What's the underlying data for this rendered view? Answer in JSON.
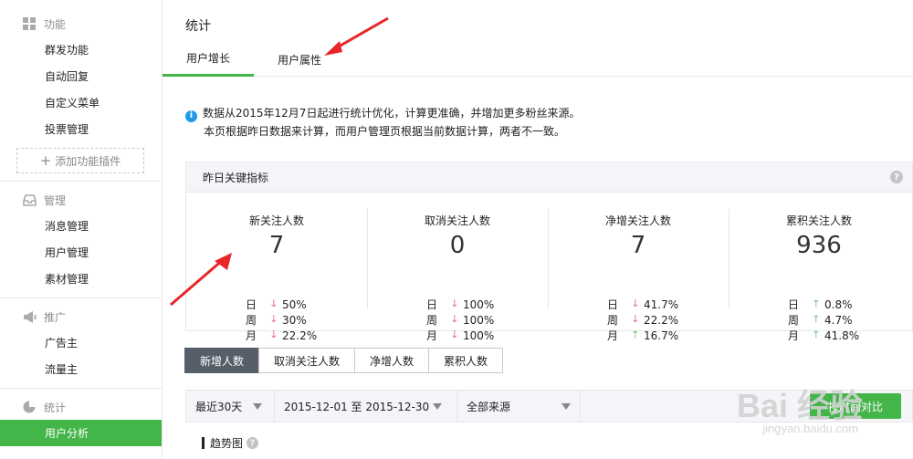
{
  "sidebar": {
    "sections": [
      {
        "title": "功能",
        "icon": "grid-icon",
        "items": [
          "群发功能",
          "自动回复",
          "自定义菜单",
          "投票管理"
        ]
      },
      {
        "title": "管理",
        "icon": "inbox-icon",
        "items": [
          "消息管理",
          "用户管理",
          "素材管理"
        ]
      },
      {
        "title": "推广",
        "icon": "megaphone-icon",
        "items": [
          "广告主",
          "流量主"
        ]
      },
      {
        "title": "统计",
        "icon": "pie-chart-icon",
        "items": [
          "用户分析"
        ]
      }
    ],
    "add_plugin": "添加功能插件",
    "active_item": "用户分析"
  },
  "page": {
    "title": "统计"
  },
  "tabs": [
    {
      "label": "用户增长",
      "active": true
    },
    {
      "label": "用户属性",
      "active": false
    }
  ],
  "notice": {
    "line1": "数据从2015年12月7日起进行统计优化，计算更准确，并增加更多粉丝来源。",
    "line2": "本页根据昨日数据来计算，而用户管理页根据当前数据计算，两者不一致。"
  },
  "kpi": {
    "header": "昨日关键指标",
    "cards": [
      {
        "label": "新关注人数",
        "value": "7",
        "rows": [
          {
            "period": "日",
            "dir": "down",
            "pct": "50%"
          },
          {
            "period": "周",
            "dir": "down",
            "pct": "30%"
          },
          {
            "period": "月",
            "dir": "down",
            "pct": "22.2%"
          }
        ]
      },
      {
        "label": "取消关注人数",
        "value": "0",
        "rows": [
          {
            "period": "日",
            "dir": "down",
            "pct": "100%"
          },
          {
            "period": "周",
            "dir": "down",
            "pct": "100%"
          },
          {
            "period": "月",
            "dir": "down",
            "pct": "100%"
          }
        ]
      },
      {
        "label": "净增关注人数",
        "value": "7",
        "rows": [
          {
            "period": "日",
            "dir": "down",
            "pct": "41.7%"
          },
          {
            "period": "周",
            "dir": "down",
            "pct": "22.2%"
          },
          {
            "period": "月",
            "dir": "up",
            "pct": "16.7%"
          }
        ]
      },
      {
        "label": "累积关注人数",
        "value": "936",
        "rows": [
          {
            "period": "日",
            "dir": "up",
            "pct": "0.8%"
          },
          {
            "period": "周",
            "dir": "up",
            "pct": "4.7%"
          },
          {
            "period": "月",
            "dir": "up",
            "pct": "41.8%"
          }
        ]
      }
    ]
  },
  "metric_tabs": [
    "新增人数",
    "取消关注人数",
    "净增人数",
    "累积人数"
  ],
  "filters": {
    "range": "最近30天",
    "dates": "2015-12-01 至 2015-12-30",
    "source": "全部来源",
    "compare": "按时间对比"
  },
  "trend": {
    "label": "趋势图"
  },
  "watermark": {
    "brand": "Bai 经验",
    "url": "jingyan.baidu.com"
  },
  "colors": {
    "accent": "#44b549",
    "down": "#e4393c",
    "info": "#1e9be8"
  }
}
